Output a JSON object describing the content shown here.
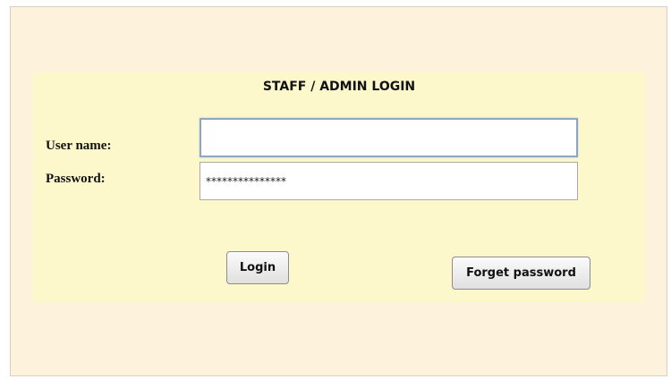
{
  "login": {
    "title": "STAFF / ADMIN LOGIN",
    "username_label": "User name:",
    "username_value": "",
    "password_label": "Password:",
    "password_value": "***************",
    "login_button": "Login",
    "forget_button": "Forget password"
  },
  "colors": {
    "outer_background": "#fdf3dc",
    "panel_background": "#fdf7cc",
    "focus_border": "#8fa6c2"
  }
}
